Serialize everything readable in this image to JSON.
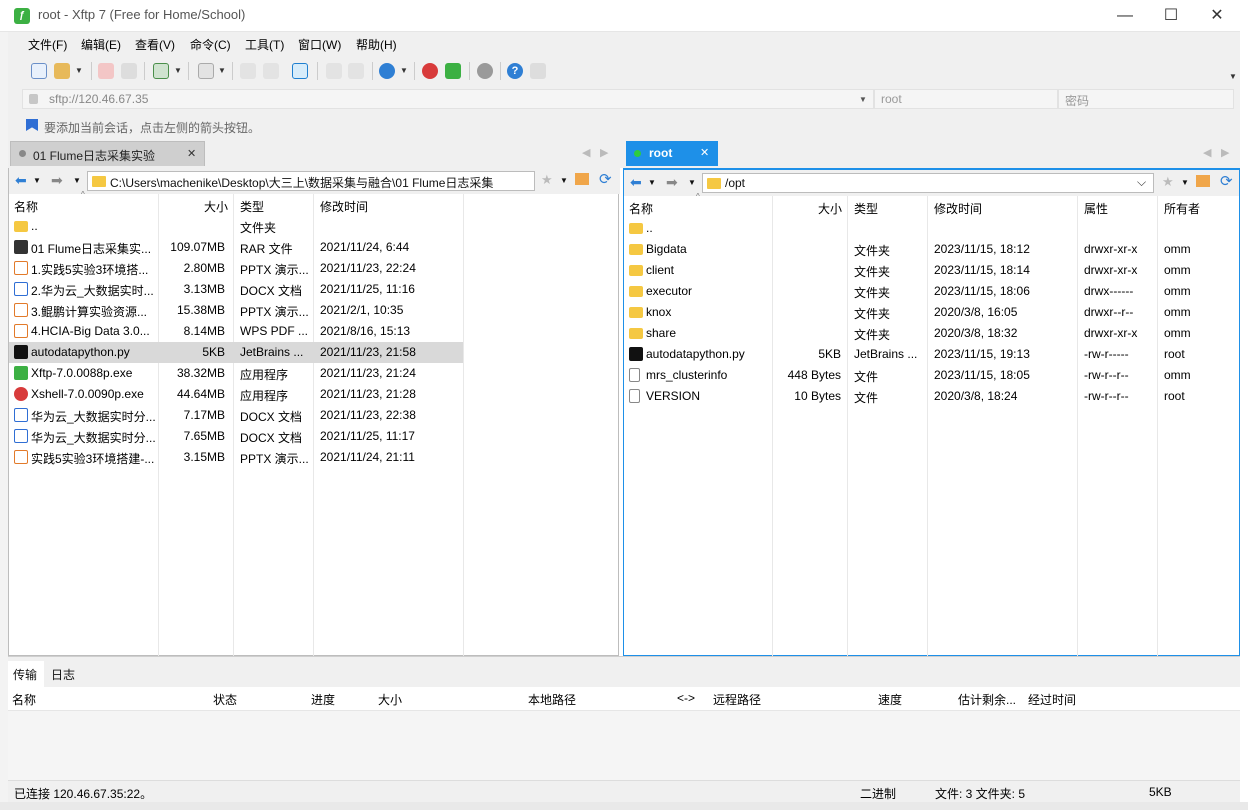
{
  "window": {
    "title": "root - Xftp 7 (Free for Home/School)",
    "controls": {
      "minimize": "—",
      "maximize": "☐",
      "close": "✕"
    }
  },
  "menu": [
    "文件(F)",
    "编辑(E)",
    "查看(V)",
    "命令(C)",
    "工具(T)",
    "窗口(W)",
    "帮助(H)"
  ],
  "address": {
    "url": "sftp://120.46.67.35",
    "user_placeholder": "root",
    "password_placeholder": "密码"
  },
  "hint": "要添加当前会话，点击左侧的箭头按钮。",
  "tabs": {
    "left": "01 Flume日志采集实验",
    "right": "root"
  },
  "left_pane": {
    "path": "C:\\Users\\machenike\\Desktop\\大三上\\数据采集与融合\\01 Flume日志采集",
    "columns": [
      "名称",
      "大小",
      "类型",
      "修改时间"
    ],
    "rows": [
      {
        "name": "..",
        "size": "",
        "type": "文件夹",
        "mtime": "",
        "icon": "folder-icon"
      },
      {
        "name": "01 Flume日志采集实...",
        "size": "109.07MB",
        "type": "RAR 文件",
        "mtime": "2021/11/24, 6:44",
        "icon": "archive-icon"
      },
      {
        "name": "1.实践5实验3环境搭...",
        "size": "2.80MB",
        "type": "PPTX 演示...",
        "mtime": "2021/11/23, 22:24",
        "icon": "pptx-icon"
      },
      {
        "name": "2.华为云_大数据实时...",
        "size": "3.13MB",
        "type": "DOCX 文档",
        "mtime": "2021/11/25, 11:16",
        "icon": "docx-icon"
      },
      {
        "name": "3.鲲鹏计算实验资源...",
        "size": "15.38MB",
        "type": "PPTX 演示...",
        "mtime": "2021/2/1, 10:35",
        "icon": "pptx-icon"
      },
      {
        "name": "4.HCIA-Big Data 3.0...",
        "size": "8.14MB",
        "type": "WPS PDF ...",
        "mtime": "2021/8/16, 15:13",
        "icon": "pdf-icon"
      },
      {
        "name": "autodatapython.py",
        "size": "5KB",
        "type": "JetBrains ...",
        "mtime": "2021/11/23, 21:58",
        "icon": "pycharm-icon",
        "selected": true
      },
      {
        "name": "Xftp-7.0.0088p.exe",
        "size": "38.32MB",
        "type": "应用程序",
        "mtime": "2021/11/23, 21:24",
        "icon": "xftp-icon"
      },
      {
        "name": "Xshell-7.0.0090p.exe",
        "size": "44.64MB",
        "type": "应用程序",
        "mtime": "2021/11/23, 21:28",
        "icon": "xshell-icon"
      },
      {
        "name": "华为云_大数据实时分...",
        "size": "7.17MB",
        "type": "DOCX 文档",
        "mtime": "2021/11/23, 22:38",
        "icon": "docx-icon"
      },
      {
        "name": "华为云_大数据实时分...",
        "size": "7.65MB",
        "type": "DOCX 文档",
        "mtime": "2021/11/25, 11:17",
        "icon": "docx-icon"
      },
      {
        "name": "实践5实验3环境搭建-...",
        "size": "3.15MB",
        "type": "PPTX 演示...",
        "mtime": "2021/11/24, 21:11",
        "icon": "pptx-icon"
      }
    ]
  },
  "right_pane": {
    "path": "/opt",
    "columns": [
      "名称",
      "大小",
      "类型",
      "修改时间",
      "属性",
      "所有者"
    ],
    "rows": [
      {
        "name": "..",
        "size": "",
        "type": "",
        "mtime": "",
        "attr": "",
        "owner": "",
        "icon": "folder-icon"
      },
      {
        "name": "Bigdata",
        "size": "",
        "type": "文件夹",
        "mtime": "2023/11/15, 18:12",
        "attr": "drwxr-xr-x",
        "owner": "omm",
        "icon": "folder-icon"
      },
      {
        "name": "client",
        "size": "",
        "type": "文件夹",
        "mtime": "2023/11/15, 18:14",
        "attr": "drwxr-xr-x",
        "owner": "omm",
        "icon": "folder-icon"
      },
      {
        "name": "executor",
        "size": "",
        "type": "文件夹",
        "mtime": "2023/11/15, 18:06",
        "attr": "drwx------",
        "owner": "omm",
        "icon": "folder-icon"
      },
      {
        "name": "knox",
        "size": "",
        "type": "文件夹",
        "mtime": "2020/3/8, 16:05",
        "attr": "drwxr--r--",
        "owner": "omm",
        "icon": "folder-icon"
      },
      {
        "name": "share",
        "size": "",
        "type": "文件夹",
        "mtime": "2020/3/8, 18:32",
        "attr": "drwxr-xr-x",
        "owner": "omm",
        "icon": "folder-icon"
      },
      {
        "name": "autodatapython.py",
        "size": "5KB",
        "type": "JetBrains ...",
        "mtime": "2023/11/15, 19:13",
        "attr": "-rw-r-----",
        "owner": "root",
        "icon": "pycharm-icon"
      },
      {
        "name": "mrs_clusterinfo",
        "size": "448 Bytes",
        "type": "文件",
        "mtime": "2023/11/15, 18:05",
        "attr": "-rw-r--r--",
        "owner": "omm",
        "icon": "file-icon"
      },
      {
        "name": "VERSION",
        "size": "10 Bytes",
        "type": "文件",
        "mtime": "2020/3/8, 18:24",
        "attr": "-rw-r--r--",
        "owner": "root",
        "icon": "file-icon"
      }
    ]
  },
  "transfer": {
    "tabs": [
      "传输",
      "日志"
    ],
    "columns": [
      "名称",
      "状态",
      "进度",
      "大小",
      "本地路径",
      "<->",
      "远程路径",
      "速度",
      "估计剩余...",
      "经过时间"
    ]
  },
  "status": {
    "connection": "已连接 120.46.67.35:22。",
    "mode": "二进制",
    "counts": "文件: 3  文件夹: 5",
    "size": "5KB"
  },
  "colors": {
    "accent": "#1e90e8",
    "selected_row": "#d9d9d9",
    "folder": "#f5c842"
  }
}
